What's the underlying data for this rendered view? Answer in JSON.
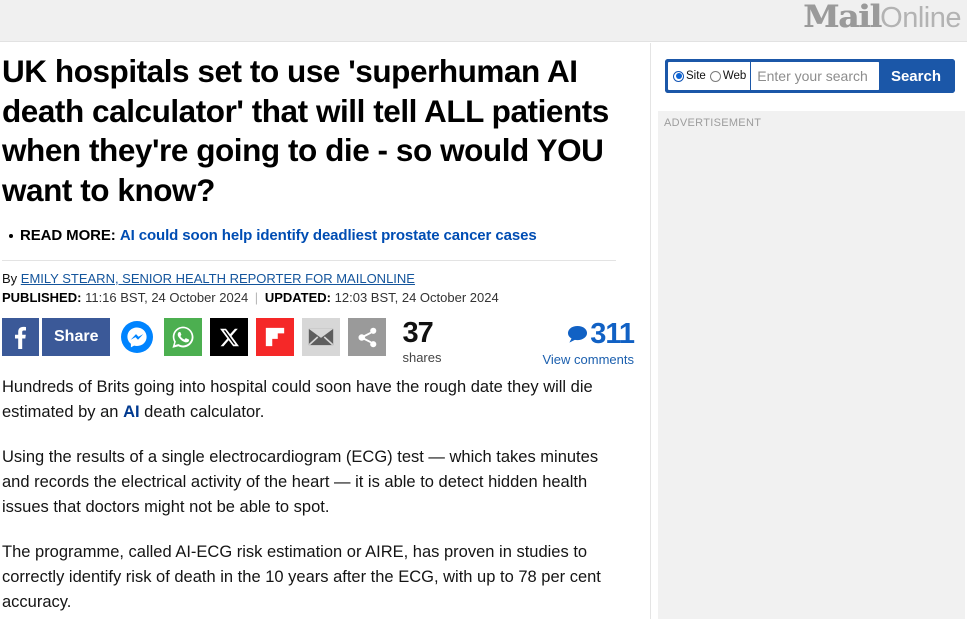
{
  "site": {
    "logo_main": "Mail",
    "logo_sub": "Online"
  },
  "search": {
    "radio_site_label": "Site",
    "radio_web_label": "Web",
    "selected_scope": "Site",
    "placeholder": "Enter your search",
    "value": "",
    "button_label": "Search",
    "magnifier_icon": "search-icon",
    "accent_color": "#1b57a8"
  },
  "sidebar": {
    "advert_label": "ADVERTISEMENT"
  },
  "article": {
    "headline": "UK hospitals set to use 'superhuman AI death calculator' that will tell ALL patients when they're going to die - so would YOU want to know?",
    "read_more": {
      "label": "READ MORE:",
      "link_text": "AI could soon help identify deadliest prostate cancer cases"
    },
    "byline": {
      "by_prefix": "By",
      "author": "EMILY STEARN, SENIOR HEALTH REPORTER FOR MAILONLINE",
      "published_label": "PUBLISHED:",
      "published_value": "11:16 BST, 24 October 2024",
      "separator": "|",
      "updated_label": "UPDATED:",
      "updated_value": "12:03 BST, 24 October 2024"
    },
    "paragraphs": [
      {
        "before": "Hundreds of Brits going into hospital could soon have the rough date they will die estimated by an ",
        "link": "AI",
        "after": " death calculator."
      },
      {
        "before": "Using the results of a single electrocardiogram (ECG) test — which takes minutes and records the electrical activity of the heart — it is able to detect hidden health issues that doctors might not be able to spot.",
        "link": "",
        "after": ""
      },
      {
        "before": "The programme, called AI-ECG risk estimation or AIRE, has proven in studies to correctly identify risk of death in the 10 years after the ECG, with up to 78 per cent accuracy.",
        "link": "",
        "after": ""
      }
    ]
  },
  "share": {
    "facebook_label": "Share",
    "facebook_color": "#3b5998",
    "messenger_color": "#0084ff",
    "whatsapp_color": "#4caf50",
    "x_color": "#000000",
    "flipboard_color": "#f52828",
    "mail_color": "#d7d7d7",
    "share_color": "#9a9a9a",
    "shares_count": "37",
    "shares_label": "shares",
    "comments_count": "311",
    "comments_label": "View comments",
    "comments_color": "#1161c4"
  }
}
